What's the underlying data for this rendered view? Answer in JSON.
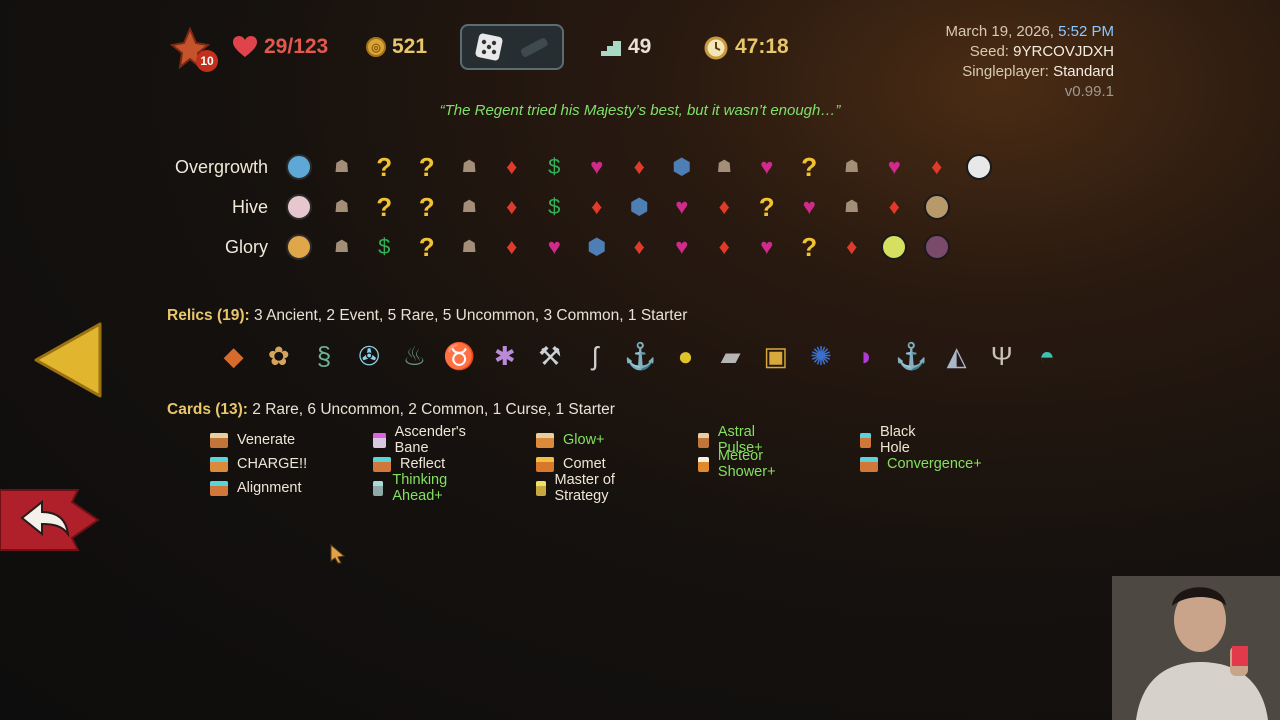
{
  "header": {
    "ascension_level": "10",
    "hp": "29/123",
    "gold": "521",
    "floor": "49",
    "time": "47:18"
  },
  "meta": {
    "date": "March 19, 2026,",
    "time": "5:52 PM",
    "seed_label": "Seed:",
    "seed_value": "9YRCOVJDXH",
    "mode_label": "Singleplayer:",
    "mode_value": "Standard",
    "version": "v0.99.1"
  },
  "quote": "“The Regent tried his Majesty’s best, but it wasn’t enough…”",
  "acts": [
    {
      "name": "Overgrowth",
      "nodes": [
        "ancient",
        "monster",
        "unknown",
        "unknown",
        "monster",
        "elite",
        "shop",
        "rest",
        "elite",
        "treasure",
        "monster",
        "rest",
        "unknown-gold",
        "monster",
        "rest",
        "elite",
        "boss"
      ]
    },
    {
      "name": "Hive",
      "nodes": [
        "ancient",
        "monster",
        "unknown",
        "unknown",
        "monster",
        "elite",
        "shop",
        "elite",
        "treasure",
        "rest",
        "elite",
        "unknown",
        "rest",
        "monster",
        "elite",
        "boss"
      ]
    },
    {
      "name": "Glory",
      "nodes": [
        "ancient",
        "monster",
        "shop",
        "unknown",
        "monster",
        "elite",
        "rest",
        "treasure",
        "elite",
        "rest",
        "elite",
        "rest",
        "unknown",
        "elite",
        "boss",
        "boss2"
      ]
    }
  ],
  "relics": {
    "label": "Relics (19):",
    "summary": "3 Ancient,  2 Event,  5 Rare,  5 Uncommon,  3 Common,  1 Starter",
    "items": [
      {
        "icon": "crystal-rock-icon",
        "glyph": "◆",
        "color": "#d76b2e"
      },
      {
        "icon": "lotus-icon",
        "glyph": "✿",
        "color": "#d8a45b"
      },
      {
        "icon": "serpent-icon",
        "glyph": "§",
        "color": "#6fb39a"
      },
      {
        "icon": "wheel-icon",
        "glyph": "✇",
        "color": "#8bd0e6"
      },
      {
        "icon": "teapot-icon",
        "glyph": "♨",
        "color": "#6c9a7b"
      },
      {
        "icon": "horned-skull-icon",
        "glyph": "♉",
        "color": "#c9a27e"
      },
      {
        "icon": "voodoo-doll-icon",
        "glyph": "✱",
        "color": "#b88ad8"
      },
      {
        "icon": "shovel-icon",
        "glyph": "⚒",
        "color": "#c9d0d6"
      },
      {
        "icon": "whip-icon",
        "glyph": "ʃ",
        "color": "#cfcfcf"
      },
      {
        "icon": "anchor-icon",
        "glyph": "⚓",
        "color": "#5fa5b5"
      },
      {
        "icon": "mango-icon",
        "glyph": "●",
        "color": "#e0c22a"
      },
      {
        "icon": "cleaver-icon",
        "glyph": "▰",
        "color": "#b5b5b5"
      },
      {
        "icon": "coin-icon",
        "glyph": "▣",
        "color": "#d8a83a"
      },
      {
        "icon": "crystal-cluster-icon",
        "glyph": "✺",
        "color": "#3a6fd0"
      },
      {
        "icon": "fan-icon",
        "glyph": "◗",
        "color": "#b03ad6"
      },
      {
        "icon": "anchor-blue-icon",
        "glyph": "⚓",
        "color": "#3b74c9"
      },
      {
        "icon": "cape-icon",
        "glyph": "◭",
        "color": "#a9b8c8"
      },
      {
        "icon": "candelabra-icon",
        "glyph": "Ψ",
        "color": "#c9c3b5"
      },
      {
        "icon": "bowl-icon",
        "glyph": "◓",
        "color": "#3fc0b0"
      }
    ]
  },
  "cards": {
    "label": "Cards (13):",
    "summary": "2 Rare,  6 Uncommon,  2 Common,  1 Curse,  1 Starter",
    "columns": [
      [
        {
          "name": "Venerate",
          "top": "#e8cfa0",
          "body": "#c0753a",
          "up": false
        },
        {
          "name": "CHARGE!!",
          "top": "#5ad4d8",
          "body": "#d98a3a",
          "up": false
        },
        {
          "name": "Alignment",
          "top": "#5ad4d8",
          "body": "#d0783a",
          "up": false
        }
      ],
      [
        {
          "name": "Ascender's Bane",
          "top": "#e060e8",
          "body": "#d8c8e0",
          "up": false
        },
        {
          "name": "Reflect",
          "top": "#5ad4d8",
          "body": "#d0783a",
          "up": false
        },
        {
          "name": "Thinking Ahead+",
          "top": "#a8dcd8",
          "body": "#8fa8a8",
          "up": true
        }
      ],
      [
        {
          "name": "Glow+",
          "top": "#e8cfa0",
          "body": "#d98a3a",
          "up": true
        },
        {
          "name": "Comet",
          "top": "#f0c040",
          "body": "#d8782a",
          "up": false
        },
        {
          "name": "Master of Strategy",
          "top": "#f0e060",
          "body": "#c8a840",
          "up": false
        }
      ],
      [
        {
          "name": "Astral Pulse+",
          "top": "#e8cfa0",
          "body": "#c0753a",
          "up": true
        },
        {
          "name": "Meteor Shower+",
          "top": "#f8f0e0",
          "body": "#e08a2a",
          "up": true
        }
      ],
      [
        {
          "name": "Black Hole",
          "top": "#5ad4d8",
          "body": "#d0783a",
          "up": false
        },
        {
          "name": "Convergence+",
          "top": "#5ad4d8",
          "body": "#d0783a",
          "up": true
        }
      ]
    ]
  }
}
